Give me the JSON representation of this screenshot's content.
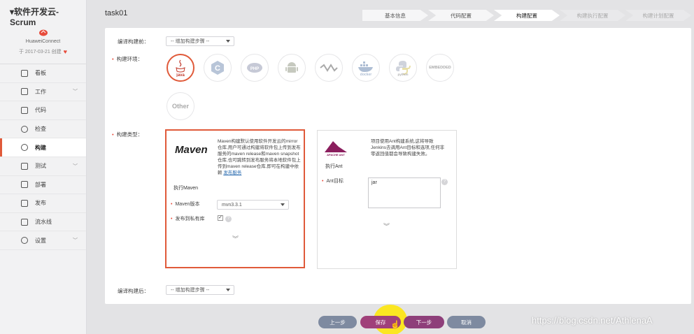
{
  "sidebar": {
    "project_title": "▾软件开发云-Scrum",
    "org": "HuaweiConnect",
    "created": "于 2017-03-21 创建",
    "items": [
      {
        "label": "看板",
        "icon": "layers-icon",
        "chevron": false
      },
      {
        "label": "工作",
        "icon": "document-icon",
        "chevron": true
      },
      {
        "label": "代码",
        "icon": "code-icon",
        "chevron": false
      },
      {
        "label": "检查",
        "icon": "globe-icon",
        "chevron": false
      },
      {
        "label": "构建",
        "icon": "gear-icon",
        "chevron": false,
        "active": true
      },
      {
        "label": "测试",
        "icon": "test-icon",
        "chevron": true
      },
      {
        "label": "部署",
        "icon": "deploy-icon",
        "chevron": false
      },
      {
        "label": "发布",
        "icon": "release-icon",
        "chevron": false
      },
      {
        "label": "流水线",
        "icon": "pipeline-icon",
        "chevron": false
      },
      {
        "label": "设置",
        "icon": "settings-icon",
        "chevron": true
      }
    ]
  },
  "header": {
    "task_name": "task01",
    "steps": [
      "基本信息",
      "代码配置",
      "构建配置",
      "构建执行配置",
      "构建计划配置"
    ]
  },
  "form": {
    "pre_build_label": "编译构建前：",
    "pre_build_select": "-- 增加构建步骤 --",
    "env_label": "构建环境：",
    "envs": [
      "java",
      "C",
      "PHP",
      "Android",
      "Node",
      "docker",
      "python",
      "EMBEDDED",
      "Other"
    ],
    "build_type_label": "构建类型：",
    "post_build_label": "编译构建后：",
    "post_build_select": "-- 增加构建步骤 --"
  },
  "maven_card": {
    "logo": "Maven",
    "description": "Maven构建默认使用软件开发云的mirror仓库,用户可通过构建将软件包上传到发布服务的maven release和maven snapshot仓库,也可跳转到发布服务将本地软件包上传到maven release仓库,即可在构建中依赖",
    "link": "发布服务",
    "subtitle": "执行Maven",
    "version_label": "Maven版本",
    "version_value": "mvn3.3.1",
    "private_repo_label": "发布到私有库",
    "checkmark": "✓"
  },
  "ant_card": {
    "logo_text": "APACHE ANT",
    "description": "项目使用Ant构建系统,这将导致Jenkins去调用Ant目标和选项,任何非零返回值都会导致构建失败。",
    "subtitle": "执行Ant",
    "target_label": "Ant目标",
    "target_value": "jar"
  },
  "buttons": {
    "prev": "上一步",
    "save": "保存",
    "next": "下一步",
    "cancel": "取消"
  },
  "watermark": "https://blog.csdn.net/AthlenaA",
  "colors": {
    "accent": "#e05a3a",
    "button_primary": "#8e3f7a",
    "button_secondary": "#7e8aa0"
  }
}
